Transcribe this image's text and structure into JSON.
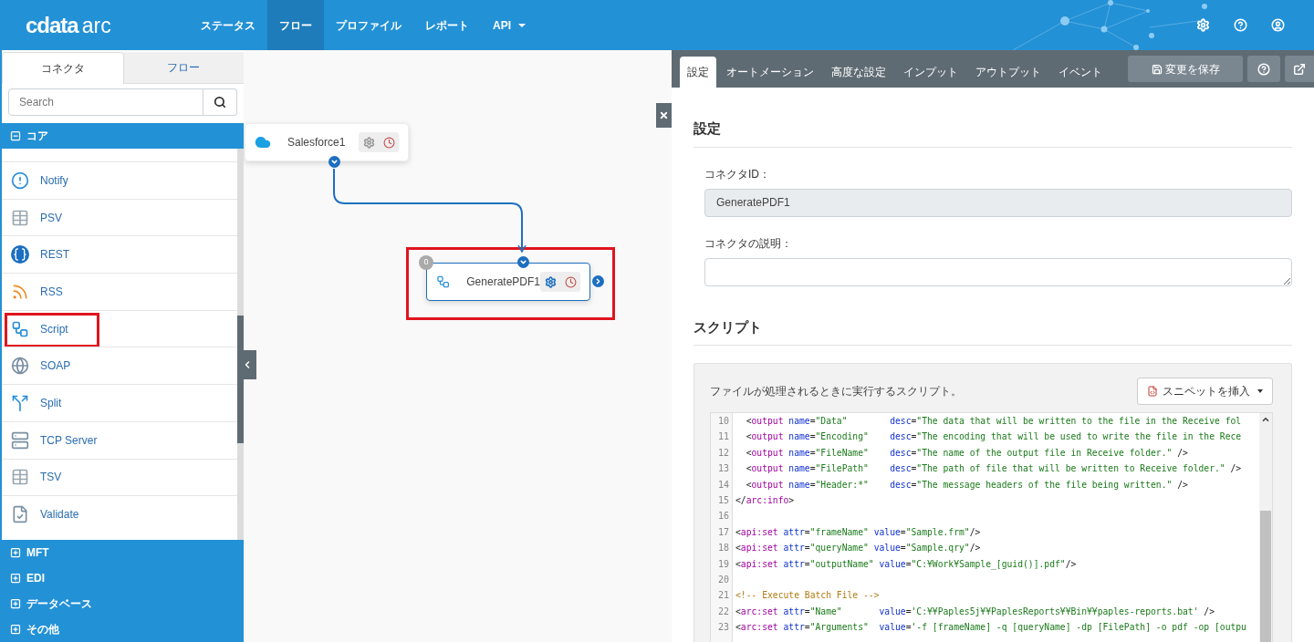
{
  "header": {
    "logo_mark": "cdata",
    "logo_text": "arc",
    "nav": [
      {
        "label": "ステータス",
        "selected": false,
        "dropdown": false
      },
      {
        "label": "フロー",
        "selected": true,
        "dropdown": false
      },
      {
        "label": "プロファイル",
        "selected": false,
        "dropdown": false
      },
      {
        "label": "レポート",
        "selected": false,
        "dropdown": false
      },
      {
        "label": "API",
        "selected": false,
        "dropdown": true
      }
    ]
  },
  "sidebar": {
    "tabs": [
      {
        "label": "コネクタ",
        "selected": true
      },
      {
        "label": "フロー",
        "selected": false
      }
    ],
    "search": {
      "placeholder": "Search"
    },
    "categories": [
      {
        "label": "コア",
        "expanded": true,
        "items": [
          {
            "label": "Notify",
            "highlighted": false
          },
          {
            "label": "PSV",
            "highlighted": false
          },
          {
            "label": "REST",
            "highlighted": false
          },
          {
            "label": "RSS",
            "highlighted": false
          },
          {
            "label": "Script",
            "highlighted": true
          },
          {
            "label": "SOAP",
            "highlighted": false
          },
          {
            "label": "Split",
            "highlighted": false
          },
          {
            "label": "TCP Server",
            "highlighted": false
          },
          {
            "label": "TSV",
            "highlighted": false
          },
          {
            "label": "Validate",
            "highlighted": false
          }
        ]
      },
      {
        "label": "MFT",
        "expanded": false
      },
      {
        "label": "EDI",
        "expanded": false
      },
      {
        "label": "データベース",
        "expanded": false
      },
      {
        "label": "その他",
        "expanded": false
      }
    ]
  },
  "canvas": {
    "nodes": [
      {
        "label": "Salesforce1",
        "selected": false,
        "highlighted": false
      },
      {
        "label": "GeneratePDF1",
        "selected": true,
        "highlighted": true,
        "badge": "0"
      }
    ]
  },
  "panel": {
    "tabs": [
      {
        "label": "設定",
        "selected": true
      },
      {
        "label": "オートメーション",
        "selected": false
      },
      {
        "label": "高度な設定",
        "selected": false
      },
      {
        "label": "インプット",
        "selected": false
      },
      {
        "label": "アウトプット",
        "selected": false
      },
      {
        "label": "イベント",
        "selected": false
      }
    ],
    "save_button": "変更を保存",
    "section_title": "設定",
    "fields": [
      {
        "label": "コネクタID：",
        "value": "GeneratePDF1",
        "disabled": true,
        "kind": "input"
      },
      {
        "label": "コネクタの説明：",
        "kind": "textarea",
        "disabled": false
      }
    ],
    "script": {
      "title": "スクリプト",
      "description": "ファイルが処理されるときに実行するスクリプト。",
      "snippet_button": "スニペットを挿入",
      "lines": [
        {
          "num": "10",
          "tokens": [
            {
              "kind": "plain",
              "text": "  <"
            },
            {
              "kind": "tag",
              "text": "output"
            },
            {
              "kind": "attr",
              "text": " name"
            },
            {
              "kind": "plain",
              "text": "="
            },
            {
              "kind": "str",
              "text": "\"Data\""
            },
            {
              "kind": "attr",
              "text": "        desc"
            },
            {
              "kind": "plain",
              "text": "="
            },
            {
              "kind": "str",
              "text": "\"The data that will be written to the file in the Receive fol"
            }
          ]
        },
        {
          "num": "11",
          "tokens": [
            {
              "kind": "plain",
              "text": "  <"
            },
            {
              "kind": "tag",
              "text": "output"
            },
            {
              "kind": "attr",
              "text": " name"
            },
            {
              "kind": "plain",
              "text": "="
            },
            {
              "kind": "str",
              "text": "\"Encoding\""
            },
            {
              "kind": "attr",
              "text": "    desc"
            },
            {
              "kind": "plain",
              "text": "="
            },
            {
              "kind": "str",
              "text": "\"The encoding that will be used to write the file in the Rece"
            }
          ]
        },
        {
          "num": "12",
          "tokens": [
            {
              "kind": "plain",
              "text": "  <"
            },
            {
              "kind": "tag",
              "text": "output"
            },
            {
              "kind": "attr",
              "text": " name"
            },
            {
              "kind": "plain",
              "text": "="
            },
            {
              "kind": "str",
              "text": "\"FileName\""
            },
            {
              "kind": "attr",
              "text": "    desc"
            },
            {
              "kind": "plain",
              "text": "="
            },
            {
              "kind": "str",
              "text": "\"The name of the output file in Receive folder.\""
            },
            {
              "kind": "plain",
              "text": " />"
            }
          ]
        },
        {
          "num": "13",
          "tokens": [
            {
              "kind": "plain",
              "text": "  <"
            },
            {
              "kind": "tag",
              "text": "output"
            },
            {
              "kind": "attr",
              "text": " name"
            },
            {
              "kind": "plain",
              "text": "="
            },
            {
              "kind": "str",
              "text": "\"FilePath\""
            },
            {
              "kind": "attr",
              "text": "    desc"
            },
            {
              "kind": "plain",
              "text": "="
            },
            {
              "kind": "str",
              "text": "\"The path of file that will be written to Receive folder.\""
            },
            {
              "kind": "plain",
              "text": " />"
            }
          ]
        },
        {
          "num": "14",
          "tokens": [
            {
              "kind": "plain",
              "text": "  <"
            },
            {
              "kind": "tag",
              "text": "output"
            },
            {
              "kind": "attr",
              "text": " name"
            },
            {
              "kind": "plain",
              "text": "="
            },
            {
              "kind": "str",
              "text": "\"Header:*\""
            },
            {
              "kind": "attr",
              "text": "    desc"
            },
            {
              "kind": "plain",
              "text": "="
            },
            {
              "kind": "str",
              "text": "\"The message headers of the file being written.\""
            },
            {
              "kind": "plain",
              "text": " />"
            }
          ]
        },
        {
          "num": "15",
          "tokens": [
            {
              "kind": "plain",
              "text": "</"
            },
            {
              "kind": "tag",
              "text": "arc:info"
            },
            {
              "kind": "plain",
              "text": ">"
            }
          ]
        },
        {
          "num": "16"
        },
        {
          "num": "17",
          "tokens": [
            {
              "kind": "plain",
              "text": "<"
            },
            {
              "kind": "tag",
              "text": "api:set"
            },
            {
              "kind": "attr",
              "text": " attr"
            },
            {
              "kind": "plain",
              "text": "="
            },
            {
              "kind": "str",
              "text": "\"frameName\""
            },
            {
              "kind": "attr",
              "text": " value"
            },
            {
              "kind": "plain",
              "text": "="
            },
            {
              "kind": "str",
              "text": "\"Sample.frm\""
            },
            {
              "kind": "plain",
              "text": "/>"
            }
          ]
        },
        {
          "num": "18",
          "tokens": [
            {
              "kind": "plain",
              "text": "<"
            },
            {
              "kind": "tag",
              "text": "api:set"
            },
            {
              "kind": "attr",
              "text": " attr"
            },
            {
              "kind": "plain",
              "text": "="
            },
            {
              "kind": "str",
              "text": "\"queryName\""
            },
            {
              "kind": "attr",
              "text": " value"
            },
            {
              "kind": "plain",
              "text": "="
            },
            {
              "kind": "str",
              "text": "\"Sample.qry\""
            },
            {
              "kind": "plain",
              "text": "/>"
            }
          ]
        },
        {
          "num": "19",
          "tokens": [
            {
              "kind": "plain",
              "text": "<"
            },
            {
              "kind": "tag",
              "text": "api:set"
            },
            {
              "kind": "attr",
              "text": " attr"
            },
            {
              "kind": "plain",
              "text": "="
            },
            {
              "kind": "str",
              "text": "\"outputName\""
            },
            {
              "kind": "attr",
              "text": " value"
            },
            {
              "kind": "plain",
              "text": "="
            },
            {
              "kind": "str",
              "text": "\"C:¥Work¥Sample_[guid()].pdf\""
            },
            {
              "kind": "plain",
              "text": "/>"
            }
          ]
        },
        {
          "num": "20"
        },
        {
          "num": "21",
          "tokens": [
            {
              "kind": "comment",
              "text": "<!-- Execute Batch File -->"
            }
          ]
        },
        {
          "num": "22",
          "tokens": [
            {
              "kind": "plain",
              "text": "<"
            },
            {
              "kind": "tag",
              "text": "arc:set"
            },
            {
              "kind": "attr",
              "text": " attr"
            },
            {
              "kind": "plain",
              "text": "="
            },
            {
              "kind": "str",
              "text": "\"Name\""
            },
            {
              "kind": "attr",
              "text": "       value"
            },
            {
              "kind": "plain",
              "text": "="
            },
            {
              "kind": "str",
              "text": "'C:¥¥Paples5j¥¥PaplesReports¥¥Bin¥¥paples-reports.bat'"
            },
            {
              "kind": "plain",
              "text": " />"
            }
          ]
        },
        {
          "num": "23",
          "tokens": [
            {
              "kind": "plain",
              "text": "<"
            },
            {
              "kind": "tag",
              "text": "arc:set"
            },
            {
              "kind": "attr",
              "text": " attr"
            },
            {
              "kind": "plain",
              "text": "="
            },
            {
              "kind": "str",
              "text": "\"Arguments\""
            },
            {
              "kind": "attr",
              "text": "  value"
            },
            {
              "kind": "plain",
              "text": "="
            },
            {
              "kind": "str",
              "text": "'-f [frameName] -q [queryName] -dp [FilePath] -o pdf -op [outpu"
            }
          ]
        }
      ]
    }
  }
}
